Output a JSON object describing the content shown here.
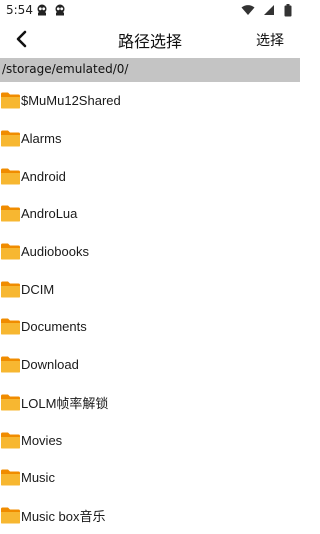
{
  "status_bar": {
    "time": "5:54",
    "app_icons": [
      "ghost-app-icon",
      "ghost-app-icon"
    ],
    "right_icons": [
      "wifi-icon",
      "signal-icon",
      "battery-icon"
    ]
  },
  "app_bar": {
    "title": "路径选择",
    "select_label": "选择",
    "back_icon": "chevron-left-icon"
  },
  "path_bar": {
    "path": "/storage/emulated/0/"
  },
  "folders": [
    {
      "name": "$MuMu12Shared"
    },
    {
      "name": "Alarms"
    },
    {
      "name": "Android"
    },
    {
      "name": "AndroLua"
    },
    {
      "name": "Audiobooks"
    },
    {
      "name": "DCIM"
    },
    {
      "name": "Documents"
    },
    {
      "name": "Download"
    },
    {
      "name": "LOLM帧率解锁"
    },
    {
      "name": "Movies"
    },
    {
      "name": "Music"
    },
    {
      "name": "Music box音乐"
    }
  ],
  "colors": {
    "folder_orange": "#f5a623",
    "folder_back": "#f08c00",
    "path_bar_bg": "#c4c4c4"
  }
}
